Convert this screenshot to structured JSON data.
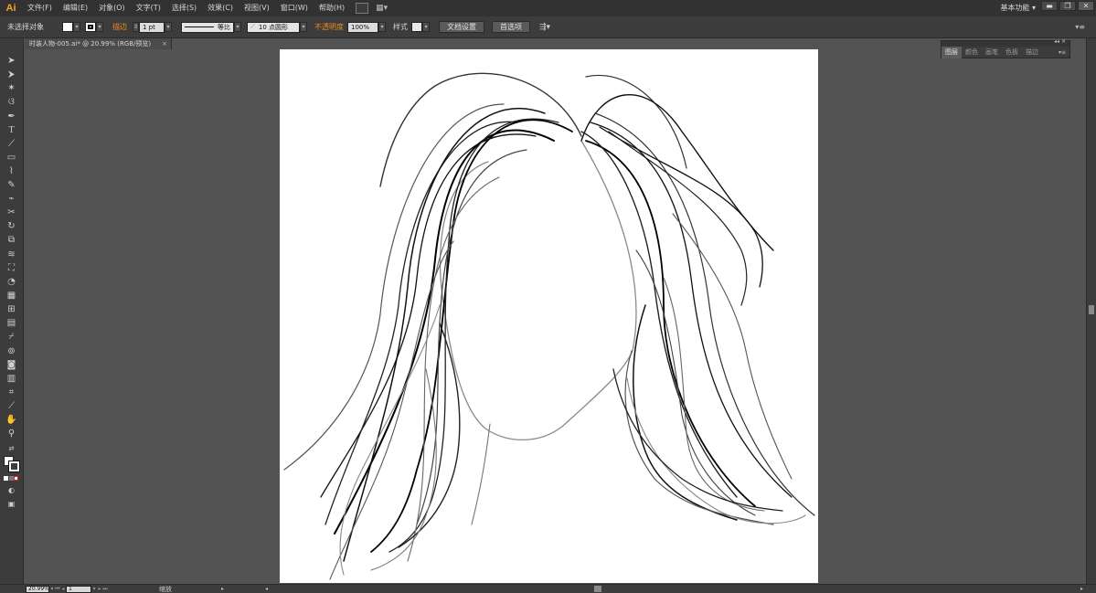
{
  "app": {
    "logo": "Ai",
    "workspace": "基本功能"
  },
  "menubar": {
    "items": [
      "文件(F)",
      "编辑(E)",
      "对象(O)",
      "文字(T)",
      "选择(S)",
      "效果(C)",
      "视图(V)",
      "窗口(W)",
      "帮助(H)"
    ]
  },
  "window_controls": {
    "minimize": "▬",
    "restore": "❐",
    "close": "✕"
  },
  "controlbar": {
    "selection": "未选择对象",
    "stroke_label": "描边",
    "stroke_weight": "1 pt",
    "stroke_profile": "等比",
    "brush": "10 点圆形",
    "opacity_label": "不透明度",
    "opacity": "100%",
    "style_label": "样式",
    "doc_setup": "文档设置",
    "preferences": "首选项"
  },
  "document": {
    "tab_title": "时装人物-005.ai* @ 20.99% (RGB/预览)",
    "close": "×"
  },
  "panel": {
    "tabs": [
      "图层",
      "颜色",
      "画笔",
      "色板",
      "描边"
    ]
  },
  "statusbar": {
    "zoom": "20.99%",
    "artboard_number": "1",
    "tool_status": "缩放"
  },
  "colors": {
    "fill": "#ffffff",
    "stroke": "#000000",
    "accent": "#f08a1c",
    "ui_bg": "#535353"
  }
}
